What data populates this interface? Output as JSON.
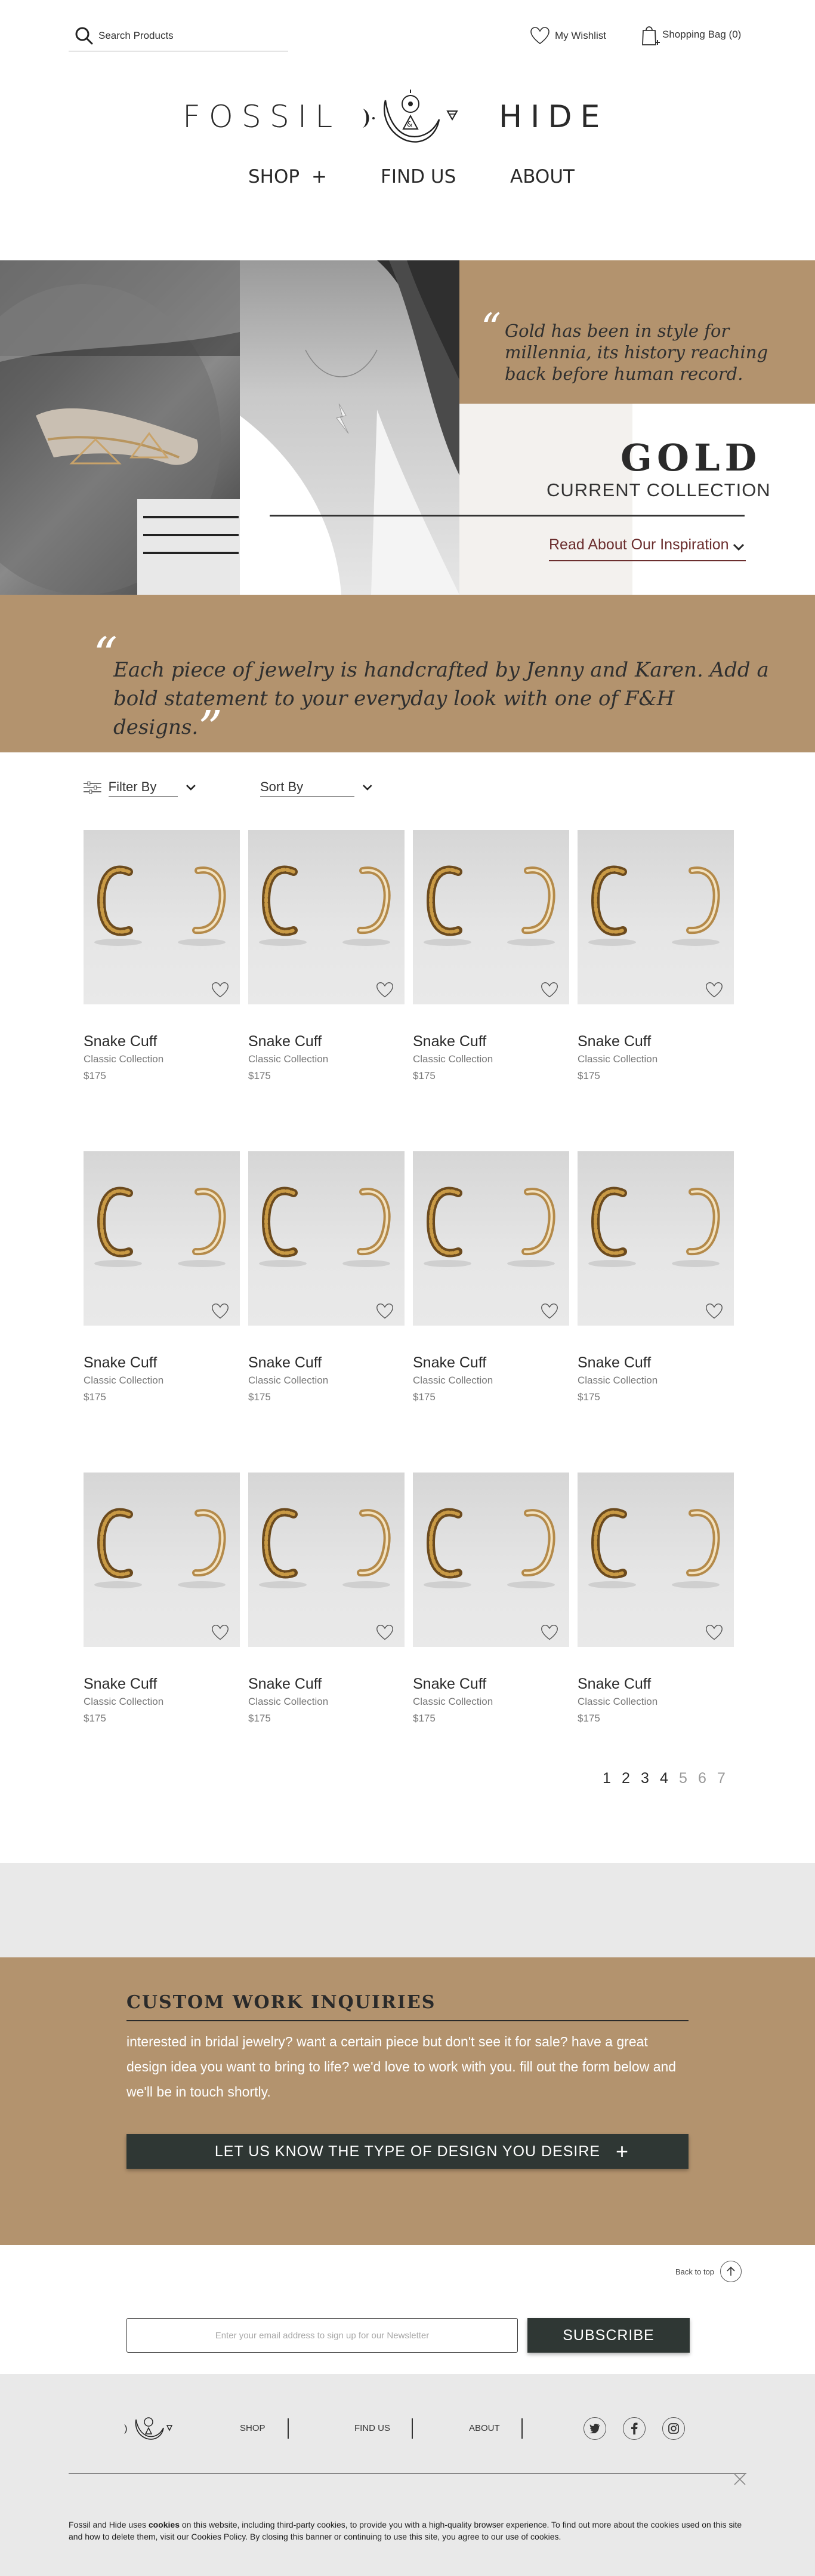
{
  "search": {
    "placeholder": "Search Products"
  },
  "header": {
    "wishlist_label": "My Wishlist",
    "bag_label": "Shopping Bag (0)"
  },
  "logo": {
    "left_word": "FOSSIL",
    "right_word": "HIDE"
  },
  "nav": [
    {
      "label": "SHOP",
      "suffix": "+"
    },
    {
      "label": "FIND US"
    },
    {
      "label": "ABOUT"
    }
  ],
  "hero": {
    "quote": "Gold has been in style for millennia, its history reaching back before human record.",
    "title": "GOLD",
    "subtitle": "CURRENT COLLECTION",
    "link_label": "Read About Our Inspiration"
  },
  "statement": {
    "text": "Each piece of jewelry is handcrafted by Jenny and Karen. Add a bold statement to your everyday look with one of F&H designs."
  },
  "filters": {
    "filter_label": "Filter By",
    "sort_label": "Sort By"
  },
  "products": [
    {
      "name": "Snake Cuff",
      "collection": "Classic Collection",
      "price": "$175"
    },
    {
      "name": "Snake Cuff",
      "collection": "Classic Collection",
      "price": "$175"
    },
    {
      "name": "Snake Cuff",
      "collection": "Classic Collection",
      "price": "$175"
    },
    {
      "name": "Snake Cuff",
      "collection": "Classic Collection",
      "price": "$175"
    },
    {
      "name": "Snake Cuff",
      "collection": "Classic Collection",
      "price": "$175"
    },
    {
      "name": "Snake Cuff",
      "collection": "Classic Collection",
      "price": "$175"
    },
    {
      "name": "Snake Cuff",
      "collection": "Classic Collection",
      "price": "$175"
    },
    {
      "name": "Snake Cuff",
      "collection": "Classic Collection",
      "price": "$175"
    },
    {
      "name": "Snake Cuff",
      "collection": "Classic Collection",
      "price": "$175"
    },
    {
      "name": "Snake Cuff",
      "collection": "Classic Collection",
      "price": "$175"
    },
    {
      "name": "Snake Cuff",
      "collection": "Classic Collection",
      "price": "$175"
    },
    {
      "name": "Snake Cuff",
      "collection": "Classic Collection",
      "price": "$175"
    }
  ],
  "pagination": {
    "pages": [
      "1",
      "2",
      "3",
      "4",
      "5",
      "6",
      "7"
    ],
    "active_through": 4
  },
  "custom": {
    "title": "CUSTOM WORK INQUIRIES",
    "body": "interested in bridal jewelry? want a certain piece but don't see it for sale? have a great design idea you want to bring to life? we'd love to work with you. fill out the form below and we'll be in touch shortly.",
    "button_label": "LET US KNOW THE TYPE OF DESIGN YOU DESIRE",
    "button_suffix": "+"
  },
  "back_to_top": "Back to top",
  "newsletter": {
    "placeholder": "Enter your email address to sign up for our Newsletter",
    "button_label": "SUBSCRIBE"
  },
  "footer": {
    "links": [
      "SHOP",
      "FIND US",
      "ABOUT"
    ],
    "social": [
      "twitter-icon",
      "facebook-icon",
      "instagram-icon"
    ],
    "cookie_before": "Fossil and Hide uses ",
    "cookie_bold": "cookies",
    "cookie_after": " on this website, including third-party cookies, to provide you with a high-quality browser experience. To find out more about the cookies used on this site and how to delete them, visit our Cookies Policy. By closing this banner or continuing to use this site, you agree to our use of cookies."
  },
  "colors": {
    "gold": "#b3936e",
    "dark_button": "#2f3734",
    "link_red": "#6b2e2e",
    "gray_band": "#e9e9e9"
  }
}
